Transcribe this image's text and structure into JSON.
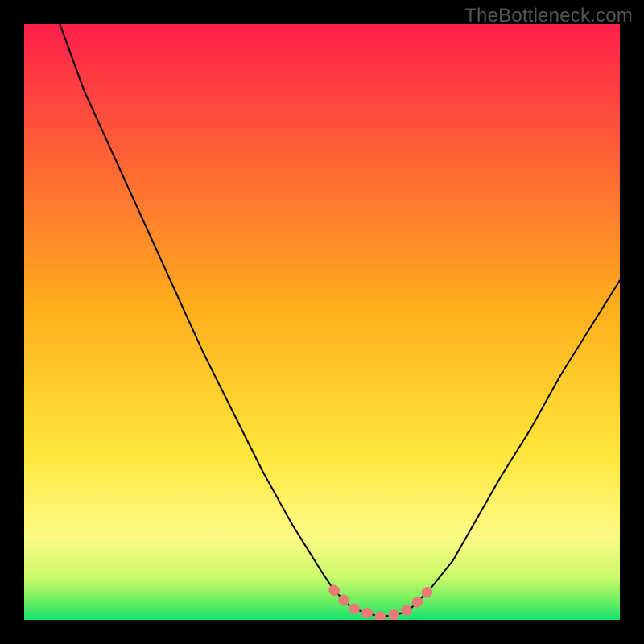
{
  "watermark": "TheBottleneck.com",
  "chart_data": {
    "type": "line",
    "title": "",
    "xlabel": "",
    "ylabel": "",
    "xlim": [
      0,
      100
    ],
    "ylim": [
      0,
      100
    ],
    "grid": false,
    "legend": false,
    "series": [
      {
        "name": "curve",
        "x": [
          6,
          10,
          15,
          20,
          25,
          30,
          35,
          40,
          45,
          50,
          52,
          55,
          58,
          60,
          63,
          65,
          68,
          72,
          76,
          80,
          85,
          90,
          95,
          100
        ],
        "y": [
          100,
          89,
          78,
          67,
          56,
          45,
          35,
          25,
          16,
          8,
          5,
          2,
          1,
          0.5,
          1,
          2,
          5,
          10,
          17,
          24,
          32,
          41,
          49,
          57
        ]
      }
    ],
    "highlight": {
      "name": "bottleneck-region",
      "x": [
        52,
        55,
        58,
        60,
        63,
        65,
        68
      ],
      "y": [
        5,
        2,
        1,
        0.5,
        1,
        2,
        5
      ],
      "color": "#e77b78"
    },
    "background_gradient": {
      "stops": [
        {
          "offset": 0.0,
          "color": "#ff1f4b"
        },
        {
          "offset": 0.48,
          "color": "#ffaf1c"
        },
        {
          "offset": 0.72,
          "color": "#ffe63a"
        },
        {
          "offset": 0.86,
          "color": "#fdfb86"
        },
        {
          "offset": 0.93,
          "color": "#c9f96a"
        },
        {
          "offset": 0.965,
          "color": "#74f05e"
        },
        {
          "offset": 1.0,
          "color": "#17e26e"
        }
      ]
    }
  }
}
